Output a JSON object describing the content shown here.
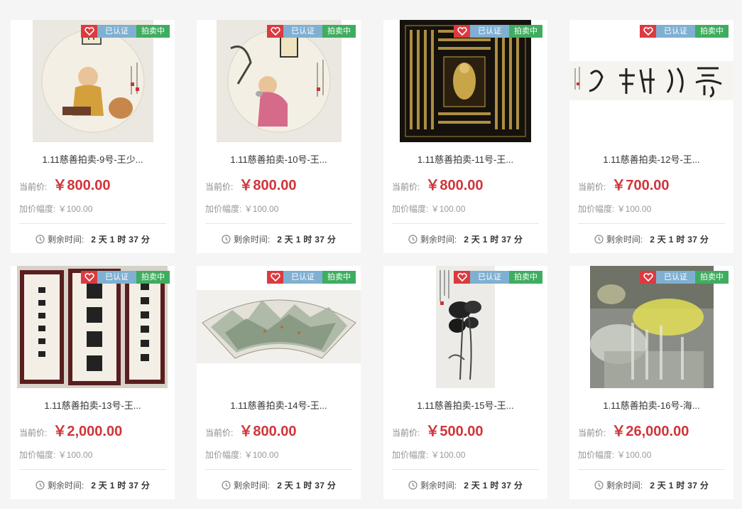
{
  "badges": {
    "certified": "已认证",
    "status": "拍卖中"
  },
  "labels": {
    "price": "当前价:",
    "increment": "加价幅度:",
    "remaining": "剩余时间:"
  },
  "icons": {
    "favorite": "heart-icon",
    "time": "clock-icon"
  },
  "colors": {
    "price": "#d0353a",
    "fav_bg": "#dc3a3f",
    "certified_bg": "#7fb0d2",
    "status_bg": "#3fad5f"
  },
  "lots": [
    {
      "title": "1.11慈善拍卖-9号-王少...",
      "price": "￥800.00",
      "increment": "￥100.00",
      "remaining": "2 天 1 时 37 分"
    },
    {
      "title": "1.11慈善拍卖-10号-王...",
      "price": "￥800.00",
      "increment": "￥100.00",
      "remaining": "2 天 1 时 37 分"
    },
    {
      "title": "1.11慈善拍卖-11号-王...",
      "price": "￥800.00",
      "increment": "￥100.00",
      "remaining": "2 天 1 时 37 分"
    },
    {
      "title": "1.11慈善拍卖-12号-王...",
      "price": "￥700.00",
      "increment": "￥100.00",
      "remaining": "2 天 1 时 37 分"
    },
    {
      "title": "1.11慈善拍卖-13号-王...",
      "price": "￥2,000.00",
      "increment": "￥100.00",
      "remaining": "2 天 1 时 37 分"
    },
    {
      "title": "1.11慈善拍卖-14号-王...",
      "price": "￥800.00",
      "increment": "￥100.00",
      "remaining": "2 天 1 时 37 分"
    },
    {
      "title": "1.11慈善拍卖-15号-王...",
      "price": "￥500.00",
      "increment": "￥100.00",
      "remaining": "2 天 1 时 37 分"
    },
    {
      "title": "1.11慈善拍卖-16号-海...",
      "price": "￥26,000.00",
      "increment": "￥100.00",
      "remaining": "2 天 1 时 37 分"
    }
  ]
}
